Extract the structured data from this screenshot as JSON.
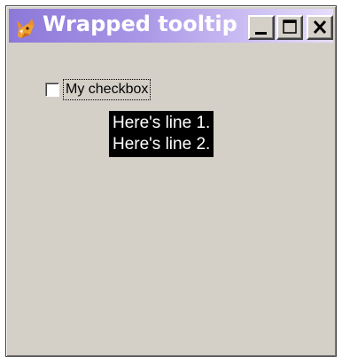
{
  "window": {
    "title": "Wrapped tooltip",
    "title_gradient": [
      "#8c78d8",
      "#e6ddfa"
    ],
    "buttons": [
      "minimize",
      "maximize",
      "close"
    ]
  },
  "checkbox": {
    "label": "My checkbox",
    "checked": false
  },
  "tooltip": {
    "lines": [
      "Here's line 1.",
      "Here's line 2."
    ],
    "background": "#000000",
    "foreground": "#ffffff"
  },
  "icons": {
    "app": "fox-app-icon"
  }
}
